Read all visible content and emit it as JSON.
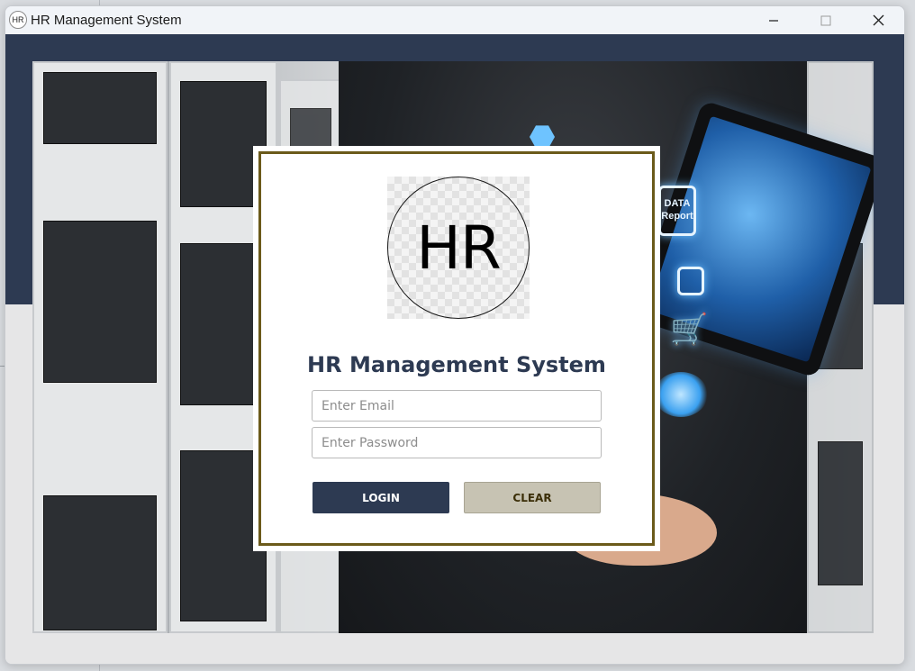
{
  "window": {
    "title": "HR Management System",
    "icon_text": "HR",
    "controls": {
      "minimize": "─",
      "maximize": "☐",
      "close": "✕"
    }
  },
  "background": {
    "holo_label": "DATA\nReport"
  },
  "login": {
    "logo_text": "HR",
    "title": "HR Management System",
    "email_placeholder": "Enter Email",
    "password_placeholder": "Enter Password",
    "login_label": "LOGIN",
    "clear_label": "CLEAR"
  },
  "colors": {
    "header_band": "#2d3a52",
    "card_border": "#6b5a1a",
    "login_button": "#2d3a52",
    "clear_button": "#c7c3b3"
  }
}
